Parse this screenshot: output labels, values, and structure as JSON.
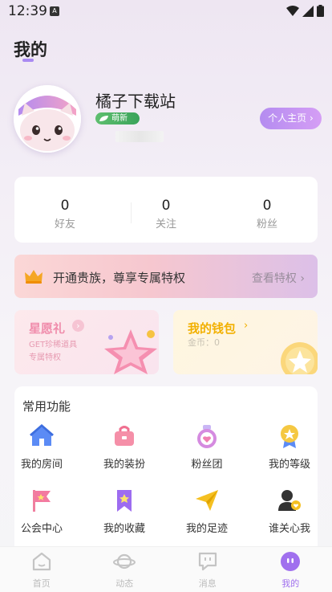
{
  "status_bar": {
    "time": "12:39",
    "notification_letter": "A"
  },
  "page": {
    "title": "我的"
  },
  "profile": {
    "username": "橘子下载站",
    "level_badge": "萌新",
    "profile_button": "个人主页"
  },
  "stats": [
    {
      "value": "0",
      "label": "好友"
    },
    {
      "value": "0",
      "label": "关注"
    },
    {
      "value": "0",
      "label": "粉丝"
    }
  ],
  "vip": {
    "text": "开通贵族，尊享专属特权",
    "link": "查看特权"
  },
  "wish": {
    "title": "星愿礼",
    "line1": "GET珍稀道具",
    "line2": "专属特权"
  },
  "wallet": {
    "title": "我的钱包",
    "coins": "金币：0"
  },
  "functions": {
    "title": "常用功能",
    "items": [
      {
        "label": "我的房间",
        "icon": "house-icon"
      },
      {
        "label": "我的装扮",
        "icon": "bag-icon"
      },
      {
        "label": "粉丝团",
        "icon": "fan-badge-icon"
      },
      {
        "label": "我的等级",
        "icon": "medal-icon"
      },
      {
        "label": "公会中心",
        "icon": "flag-icon"
      },
      {
        "label": "我的收藏",
        "icon": "bookmark-icon"
      },
      {
        "label": "我的足迹",
        "icon": "paper-plane-icon"
      },
      {
        "label": "谁关心我",
        "icon": "user-heart-icon"
      }
    ]
  },
  "nav": [
    {
      "label": "首页",
      "icon": "home-icon"
    },
    {
      "label": "动态",
      "icon": "planet-icon"
    },
    {
      "label": "消息",
      "icon": "chat-icon"
    },
    {
      "label": "我的",
      "icon": "me-icon",
      "active": true
    }
  ],
  "colors": {
    "accent": "#a070ee",
    "gold": "#f2b000",
    "pink": "#f08dac"
  }
}
